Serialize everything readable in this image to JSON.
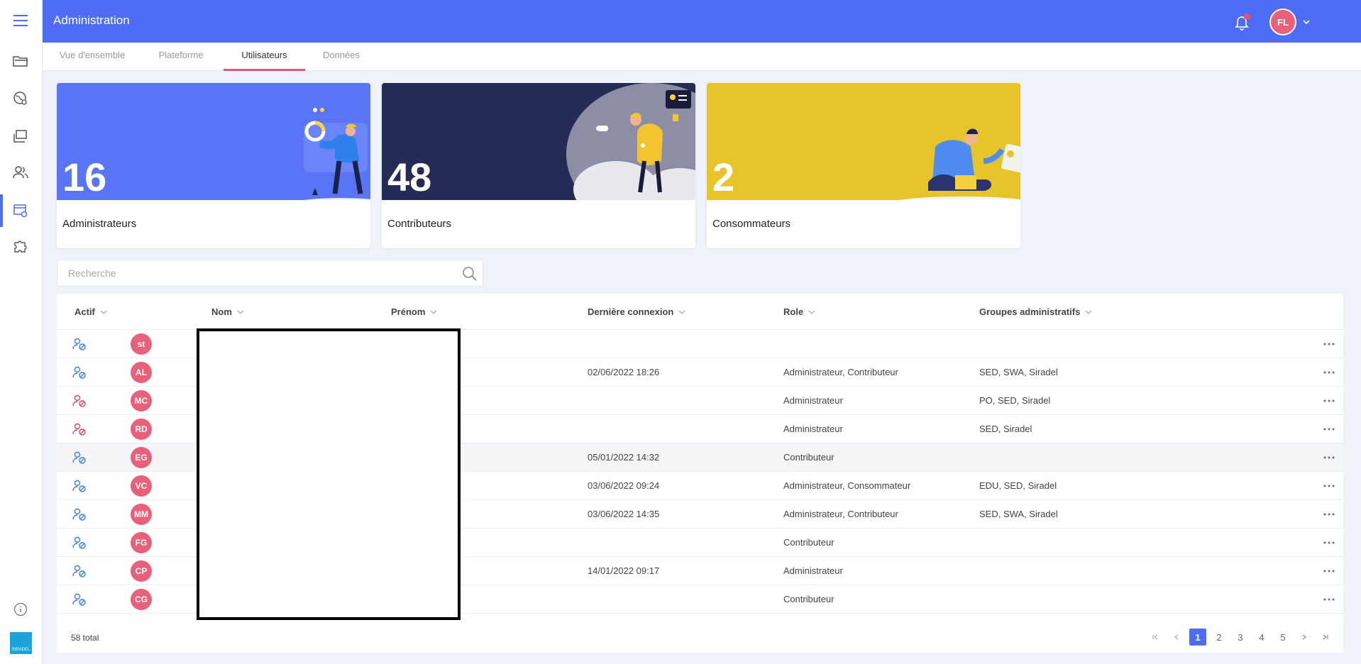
{
  "header": {
    "title": "Administration",
    "user_initials": "FL"
  },
  "tabs": [
    "Vue d'ensemble",
    "Plateforme",
    "Utilisateurs",
    "Données"
  ],
  "active_tab": "Utilisateurs",
  "cards": [
    {
      "count": "16",
      "label": "Administrateurs",
      "color": "#5a74f6"
    },
    {
      "count": "48",
      "label": "Contributeurs",
      "color": "#262b56"
    },
    {
      "count": "2",
      "label": "Consommateurs",
      "color": "#e7c52a"
    }
  ],
  "search": {
    "placeholder": "Recherche"
  },
  "table": {
    "columns": [
      "Actif",
      "Nom",
      "Prénom",
      "Dernière connexion",
      "Role",
      "Groupes administratifs"
    ],
    "rows": [
      {
        "status": "active",
        "initials": "st",
        "last_login": "",
        "role": "",
        "groups": ""
      },
      {
        "status": "active",
        "initials": "AL",
        "last_login": "02/06/2022 18:26",
        "role": "Administrateur, Contributeur",
        "groups": "SED, SWA, Siradel"
      },
      {
        "status": "inactive",
        "initials": "MC",
        "last_login": "",
        "role": "Administrateur",
        "groups": "PO, SED, Siradel"
      },
      {
        "status": "inactive",
        "initials": "RD",
        "last_login": "",
        "role": "Administrateur",
        "groups": "SED, Siradel"
      },
      {
        "status": "active",
        "initials": "EG",
        "last_login": "05/01/2022 14:32",
        "role": "Contributeur",
        "groups": ""
      },
      {
        "status": "active",
        "initials": "VC",
        "last_login": "03/06/2022 09:24",
        "role": "Administrateur, Consommateur",
        "groups": "EDU, SED, Siradel"
      },
      {
        "status": "active",
        "initials": "MM",
        "last_login": "03/06/2022 14:35",
        "role": "Administrateur, Contributeur",
        "groups": "SED, SWA, Siradel"
      },
      {
        "status": "active",
        "initials": "FG",
        "last_login": "",
        "role": "Contributeur",
        "groups": ""
      },
      {
        "status": "active",
        "initials": "CP",
        "last_login": "14/01/2022 09:17",
        "role": "Administrateur",
        "groups": ""
      },
      {
        "status": "active",
        "initials": "CG",
        "last_login": "",
        "role": "Contributeur",
        "groups": ""
      }
    ],
    "total": "58 total",
    "pages": [
      "1",
      "2",
      "3",
      "4",
      "5"
    ],
    "current_page": "1"
  },
  "logo_text": "SIRADEL",
  "colors": {
    "accent": "#4f6cf5",
    "avatar": "#e9607a",
    "tab_underline": "#e3577b",
    "status_active": "#3f7ee8",
    "status_inactive": "#e0455f"
  }
}
